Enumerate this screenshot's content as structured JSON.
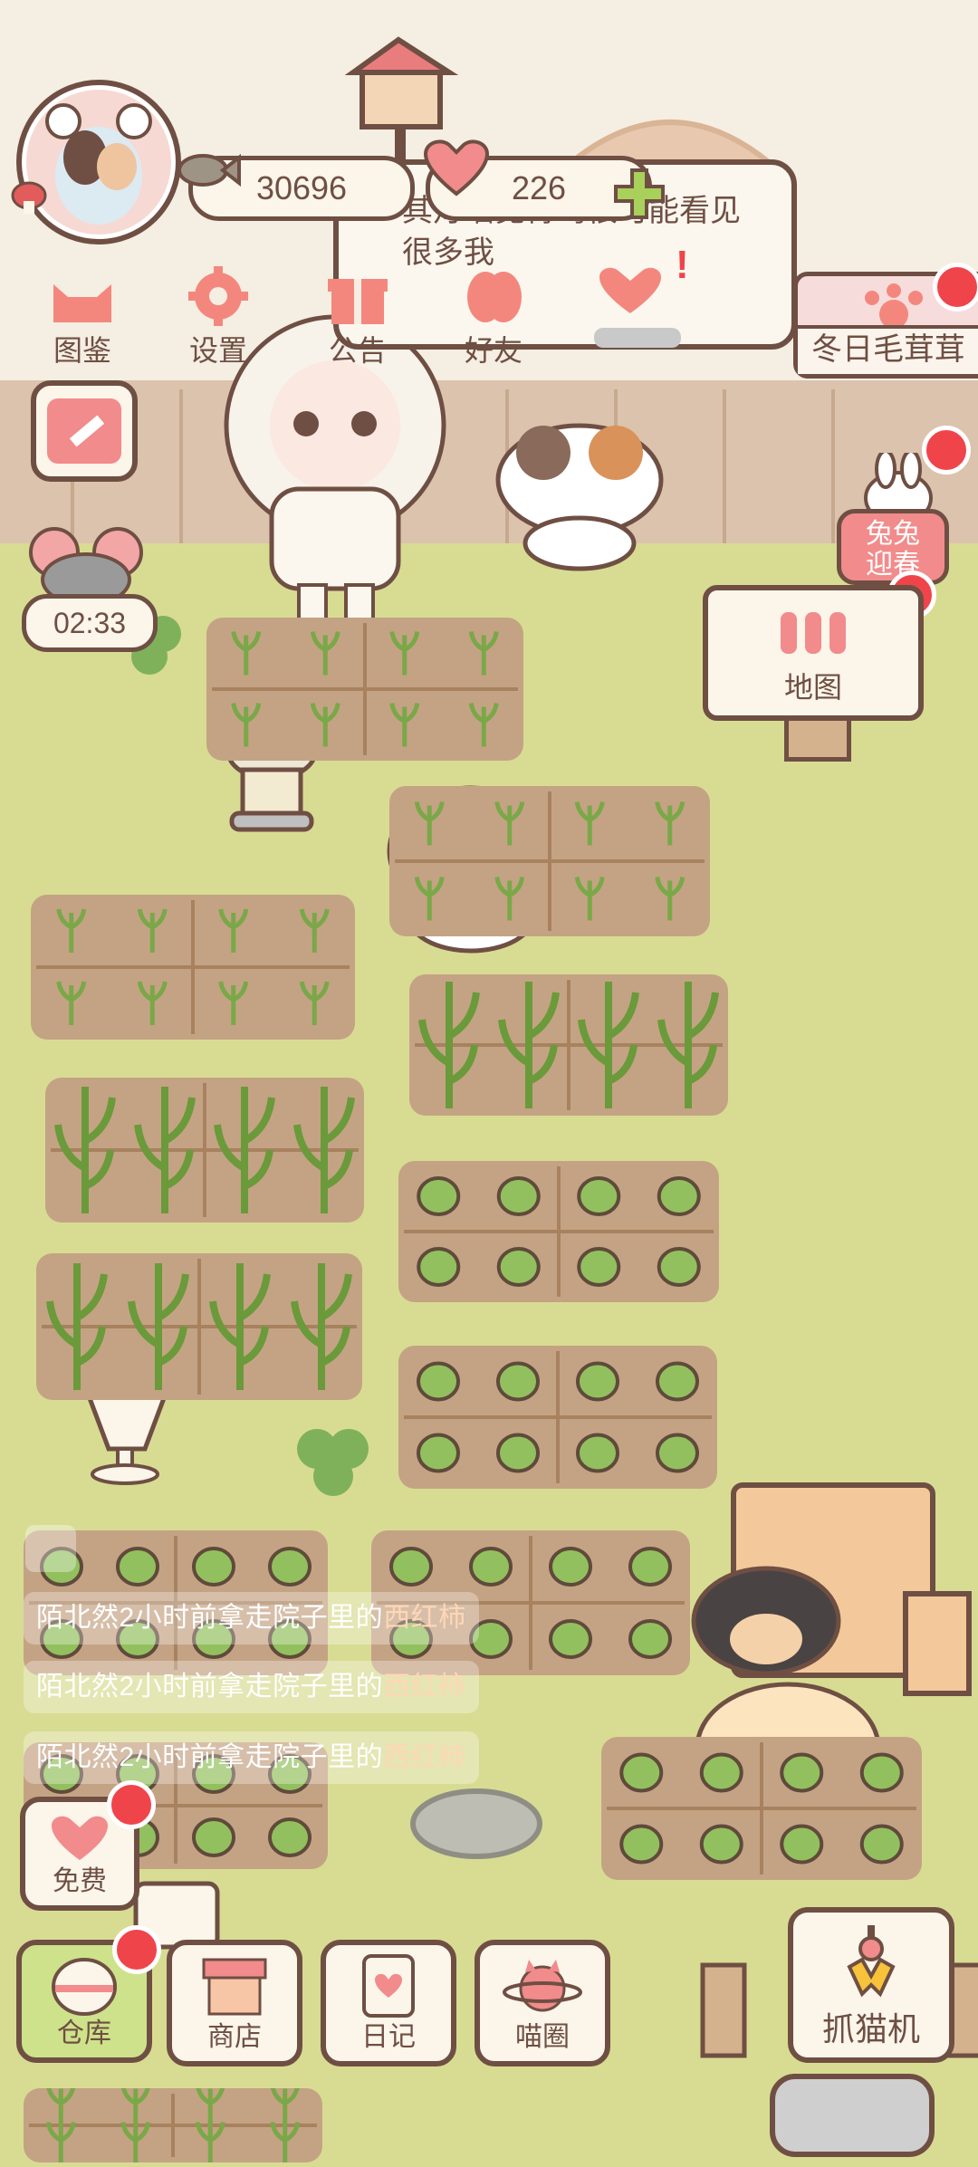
{
  "resources": {
    "coins": "30696",
    "hearts": "226"
  },
  "speech": {
    "text": "其灯喵觉得鸟很可能看见很多我"
  },
  "top_menu": [
    {
      "label": "图鉴",
      "icon": "cat-face-icon"
    },
    {
      "label": "设置",
      "icon": "gear-icon"
    },
    {
      "label": "公告",
      "icon": "gift-icon"
    },
    {
      "label": "好友",
      "icon": "friends-icon"
    }
  ],
  "event": {
    "banner_label": "冬日毛茸茸",
    "rabbit_label": "兔兔迎春"
  },
  "timer": {
    "value": "02:33"
  },
  "map_sign": {
    "label": "地图"
  },
  "feed": [
    {
      "prefix": "陌北然2小时前拿走院子里的",
      "item": "西红柿"
    },
    {
      "prefix": "陌北然2小时前拿走院子里的",
      "item": "西红柿"
    },
    {
      "prefix": "陌北然2小时前拿走院子里的",
      "item": "西红柿"
    }
  ],
  "free_button": {
    "label": "免费"
  },
  "bottom_nav": [
    {
      "label": "仓库",
      "icon": "warehouse-icon"
    },
    {
      "label": "商店",
      "icon": "shop-icon"
    },
    {
      "label": "日记",
      "icon": "diary-icon"
    },
    {
      "label": "喵圈",
      "icon": "cat-planet-icon"
    }
  ],
  "claw_machine": {
    "label": "抓猫机"
  },
  "colors": {
    "ground": "#d8dc92",
    "outline": "#6f4f43",
    "accent_red": "#f0444b",
    "soil": "#c4a384"
  }
}
